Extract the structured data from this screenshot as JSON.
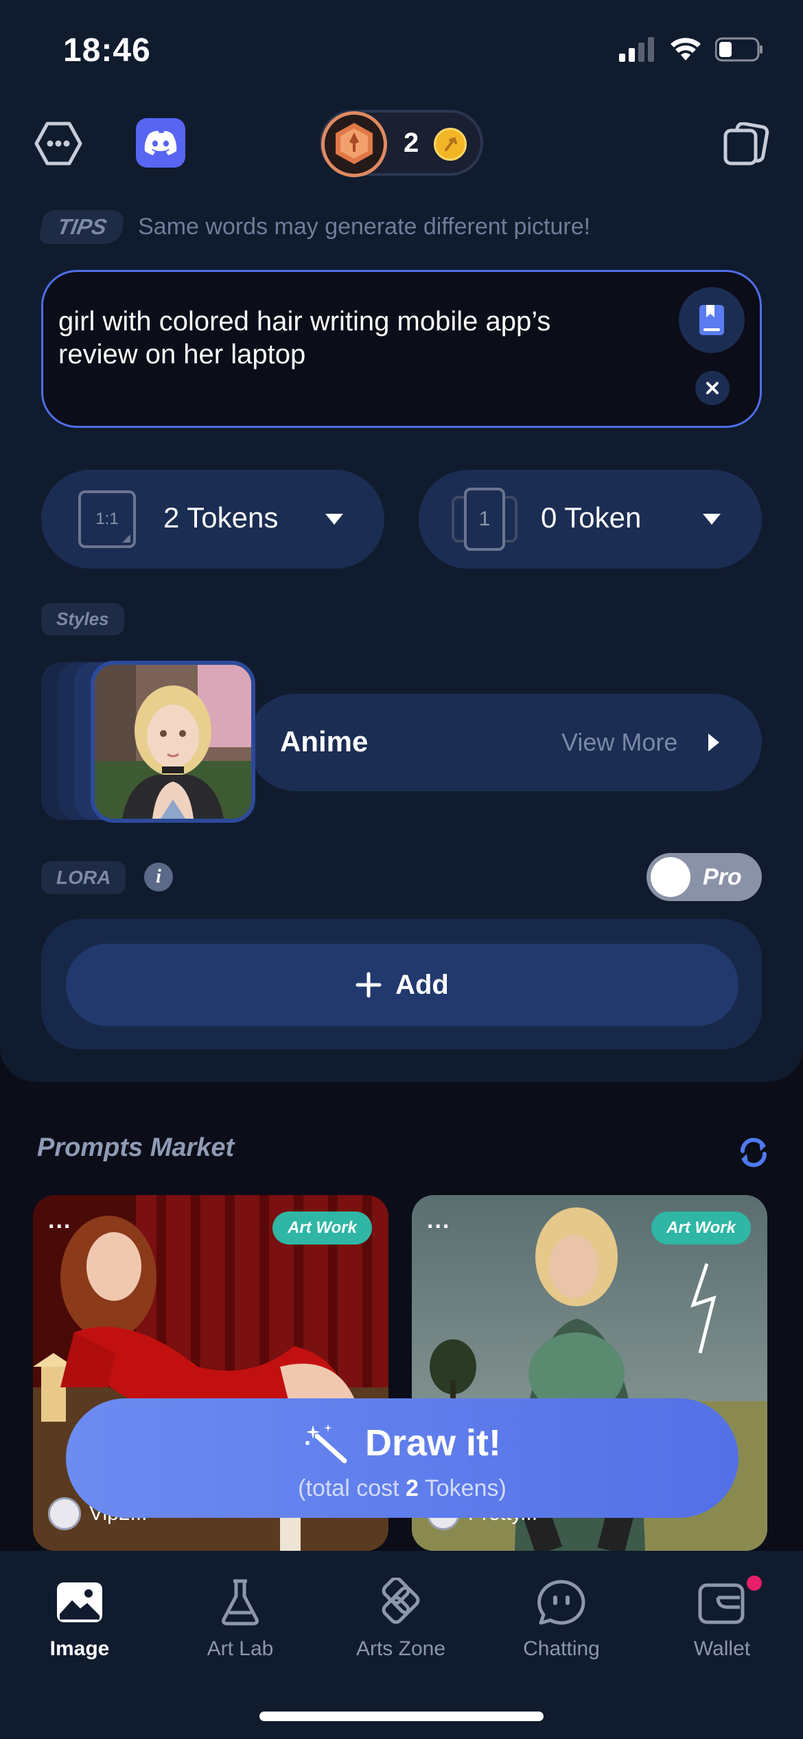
{
  "status_bar": {
    "time": "18:46"
  },
  "header": {
    "coin_count": "2"
  },
  "tips": {
    "badge": "TIPS",
    "text": "Same words may generate different picture!"
  },
  "prompt": {
    "text": "girl with colored hair writing mobile app’s review on her laptop"
  },
  "selectors": {
    "ratio": {
      "icon_text": "1:1",
      "label": "2 Tokens"
    },
    "count": {
      "icon_text": "1",
      "label": "0 Token"
    }
  },
  "styles": {
    "badge": "Styles",
    "selected": "Anime",
    "view_more": "View More"
  },
  "lora": {
    "badge": "LORA",
    "info": "i",
    "pro_label": "Pro",
    "add_label": "Add"
  },
  "market": {
    "title": "Prompts Market",
    "cards": [
      {
        "tag": "Art Work",
        "more": "...",
        "author": "Vip2..."
      },
      {
        "tag": "Art Work",
        "more": "...",
        "author": "Pretty..."
      }
    ]
  },
  "draw": {
    "label": "Draw it!",
    "cost_prefix": "(total cost ",
    "cost_value": "2",
    "cost_suffix": " Tokens)"
  },
  "tabs": [
    {
      "label": "Image",
      "active": true
    },
    {
      "label": "Art Lab",
      "active": false
    },
    {
      "label": "Arts Zone",
      "active": false
    },
    {
      "label": "Chatting",
      "active": false
    },
    {
      "label": "Wallet",
      "active": false
    }
  ],
  "colors": {
    "accent": "#4d6ee8",
    "panel": "#101b2e",
    "pill": "#1b2d52",
    "tag": "#2fb6a5",
    "notification": "#e8206a"
  }
}
